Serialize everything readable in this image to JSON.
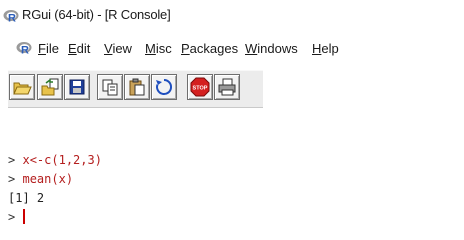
{
  "window": {
    "title": "RGui (64-bit) - [R Console]"
  },
  "menu": {
    "items": [
      {
        "underline": "F",
        "rest": "ile"
      },
      {
        "underline": "E",
        "rest": "dit"
      },
      {
        "underline": "V",
        "rest": "iew"
      },
      {
        "underline": "M",
        "rest": "isc"
      },
      {
        "underline": "P",
        "rest": "ackages"
      },
      {
        "underline": "W",
        "rest": "indows"
      },
      {
        "underline": "H",
        "rest": "elp"
      }
    ]
  },
  "toolbar": {
    "buttons": [
      {
        "icon": "open-script-icon"
      },
      {
        "icon": "load-workspace-icon"
      },
      {
        "icon": "save-workspace-icon"
      },
      {
        "icon": "copy-icon"
      },
      {
        "icon": "paste-icon"
      },
      {
        "icon": "copy-paste-icon"
      },
      {
        "icon": "stop-icon",
        "label": "STOP"
      },
      {
        "icon": "print-icon"
      }
    ]
  },
  "console": {
    "lines": [
      {
        "prompt": ">",
        "text": "x<-c(1,2,3)"
      },
      {
        "prompt": ">",
        "text": "mean(x)"
      },
      {
        "output": "[1] 2"
      },
      {
        "prompt": ">",
        "text": ""
      }
    ]
  },
  "colors": {
    "command": "#b41e1e",
    "r_logo_blue": "#2a5cb8",
    "r_logo_grey": "#8c8c8c"
  }
}
